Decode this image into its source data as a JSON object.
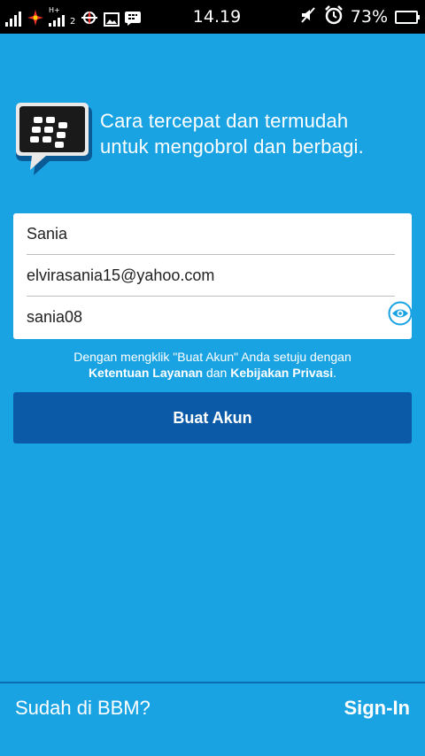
{
  "status_bar": {
    "sim1_label": "",
    "sim2_label": "2",
    "network_type": "H+",
    "time": "14.19",
    "battery_percent": "73%",
    "battery_level": 0.73,
    "icons": [
      "signal-bars-icon",
      "sim-number-icon",
      "app-flower-icon",
      "network-hplus-icon",
      "signal-bars-2-icon",
      "compass-icon",
      "image-icon",
      "bbm-notification-icon",
      "mute-icon",
      "alarm-icon",
      "battery-icon"
    ]
  },
  "header": {
    "logo": "bbm-logo-icon",
    "tagline_line1": "Cara tercepat dan termudah",
    "tagline_line2": "untuk mengobrol dan berbagi."
  },
  "form": {
    "name_value": "Sania",
    "email_value": "elvirasania15@yahoo.com",
    "password_value": "sania08",
    "show_password_icon": "eye-icon"
  },
  "terms": {
    "line1": "Dengan mengklik \"Buat Akun\" Anda setuju dengan",
    "tos_link": "Ketentuan Layanan",
    "and_text": "dan",
    "privacy_link": "Kebijakan Privasi",
    "period": "."
  },
  "buttons": {
    "create_account": "Buat Akun"
  },
  "footer": {
    "question": "Sudah di BBM?",
    "signin": "Sign-In"
  },
  "colors": {
    "background": "#1aa3e3",
    "button": "#0b5aa8",
    "statusbar": "#000000",
    "eye_icon": "#1aa3e3"
  }
}
